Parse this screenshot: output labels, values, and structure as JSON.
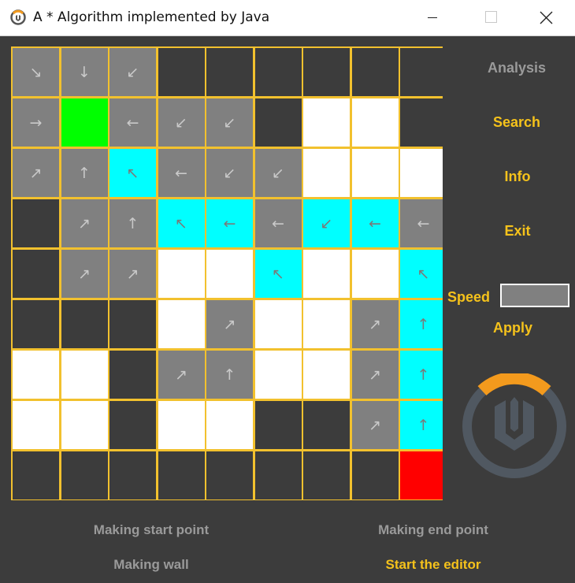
{
  "window": {
    "title": "A * Algorithm implemented by Java",
    "app_icon": "overwatch-logo-icon"
  },
  "colors": {
    "background": "#3c3c3c",
    "grid_line": "#f2c12e",
    "wall": "#3c3c3c",
    "open": "#ffffff",
    "visited": "#808080",
    "path": "#00ffff",
    "start": "#00ff00",
    "end": "#ff0000",
    "accent": "#f5c21b",
    "disabled_text": "#9a9a9a"
  },
  "legend": {
    "W": "wall",
    "O": "open",
    "V": "visited",
    "P": "path",
    "S": "start",
    "E": "end"
  },
  "grid": {
    "rows": [
      [
        [
          "V",
          "↘"
        ],
        [
          "V",
          "↓"
        ],
        [
          "V",
          "↙"
        ],
        [
          "W",
          ""
        ],
        [
          "W",
          ""
        ],
        [
          "W",
          ""
        ],
        [
          "W",
          ""
        ],
        [
          "W",
          ""
        ],
        [
          "W",
          ""
        ]
      ],
      [
        [
          "V",
          "→"
        ],
        [
          "S",
          ""
        ],
        [
          "V",
          "←"
        ],
        [
          "V",
          "↙"
        ],
        [
          "V",
          "↙"
        ],
        [
          "W",
          ""
        ],
        [
          "O",
          ""
        ],
        [
          "O",
          ""
        ],
        [
          "W",
          ""
        ]
      ],
      [
        [
          "V",
          "↗"
        ],
        [
          "V",
          "↑"
        ],
        [
          "P",
          "↖"
        ],
        [
          "V",
          "←"
        ],
        [
          "V",
          "↙"
        ],
        [
          "V",
          "↙"
        ],
        [
          "O",
          ""
        ],
        [
          "O",
          ""
        ],
        [
          "O",
          ""
        ]
      ],
      [
        [
          "W",
          ""
        ],
        [
          "V",
          "↗"
        ],
        [
          "V",
          "↑"
        ],
        [
          "P",
          "↖"
        ],
        [
          "P",
          "←"
        ],
        [
          "V",
          "←"
        ],
        [
          "P",
          "↙"
        ],
        [
          "P",
          "←"
        ],
        [
          "V",
          "←"
        ]
      ],
      [
        [
          "W",
          ""
        ],
        [
          "V",
          "↗"
        ],
        [
          "V",
          "↗"
        ],
        [
          "O",
          ""
        ],
        [
          "O",
          ""
        ],
        [
          "P",
          "↖"
        ],
        [
          "O",
          ""
        ],
        [
          "O",
          ""
        ],
        [
          "P",
          "↖"
        ]
      ],
      [
        [
          "W",
          ""
        ],
        [
          "W",
          ""
        ],
        [
          "W",
          ""
        ],
        [
          "O",
          ""
        ],
        [
          "V",
          "↗"
        ],
        [
          "O",
          ""
        ],
        [
          "O",
          ""
        ],
        [
          "V",
          "↗"
        ],
        [
          "P",
          "↑"
        ]
      ],
      [
        [
          "O",
          ""
        ],
        [
          "O",
          ""
        ],
        [
          "W",
          ""
        ],
        [
          "V",
          "↗"
        ],
        [
          "V",
          "↑"
        ],
        [
          "O",
          ""
        ],
        [
          "O",
          ""
        ],
        [
          "V",
          "↗"
        ],
        [
          "P",
          "↑"
        ]
      ],
      [
        [
          "O",
          ""
        ],
        [
          "O",
          ""
        ],
        [
          "W",
          ""
        ],
        [
          "O",
          ""
        ],
        [
          "O",
          ""
        ],
        [
          "W",
          ""
        ],
        [
          "W",
          ""
        ],
        [
          "V",
          "↗"
        ],
        [
          "P",
          "↑"
        ]
      ],
      [
        [
          "W",
          ""
        ],
        [
          "W",
          ""
        ],
        [
          "W",
          ""
        ],
        [
          "W",
          ""
        ],
        [
          "W",
          ""
        ],
        [
          "W",
          ""
        ],
        [
          "W",
          ""
        ],
        [
          "W",
          ""
        ],
        [
          "E",
          ""
        ]
      ]
    ]
  },
  "side_panel": {
    "analysis": "Analysis",
    "search": "Search",
    "info": "Info",
    "exit": "Exit",
    "speed_label": "Speed",
    "speed_value": "",
    "apply": "Apply",
    "logo": "overwatch-logo-icon"
  },
  "bottom": {
    "making_start": "Making start point",
    "making_end": "Making end point",
    "making_wall": "Making wall",
    "start_editor": "Start the editor"
  }
}
